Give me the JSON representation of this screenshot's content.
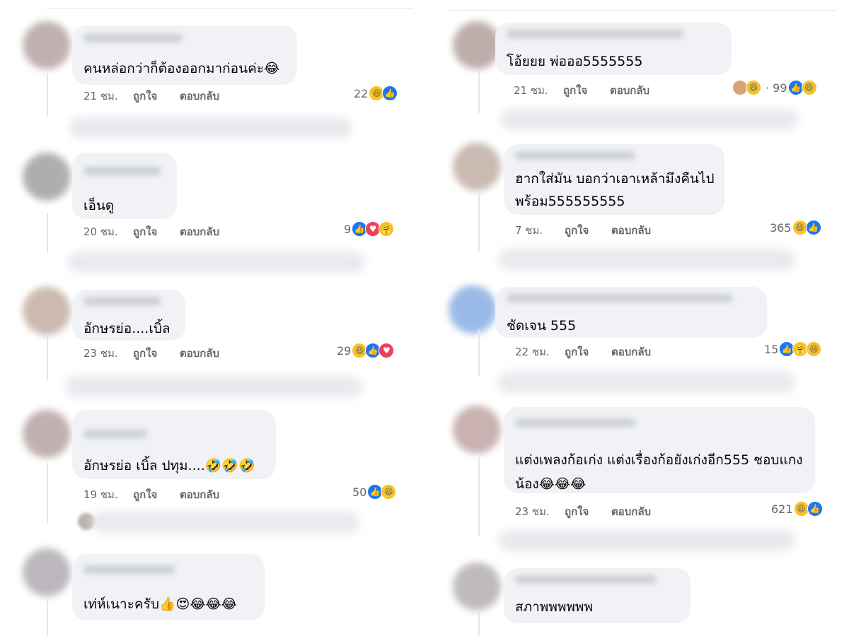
{
  "actions": {
    "like": "ถูกใจ",
    "reply": "ตอบกลับ"
  },
  "left": [
    {
      "text": "คนหล่อกว่าก็ต้องออกมาก่อนค่ะ😂",
      "time": "21 ชม.",
      "count": "22",
      "reactions": [
        "haha-icon",
        "like-icon"
      ]
    },
    {
      "text": "เอ็นดู",
      "time": "20 ชม.",
      "count": "9",
      "reactions": [
        "like-icon",
        "love-icon",
        "care-icon"
      ]
    },
    {
      "text": "อักษรย่อ....เบิ้ล",
      "time": "23 ชม.",
      "count": "29",
      "reactions": [
        "haha-icon",
        "like-icon",
        "love-icon"
      ]
    },
    {
      "text": "อักษรย่อ เบิ้ล ปทุม....🤣🤣🤣",
      "time": "19 ชม.",
      "count": "50",
      "reactions": [
        "like-icon",
        "haha-icon"
      ]
    },
    {
      "text": "เท่ห์เนาะครับ👍😍😂😂😂"
    }
  ],
  "right": [
    {
      "text": "โอ้ยยย พ่อออ5555555",
      "time": "21 ชม.",
      "count": "· 99",
      "reactions": [
        "like-icon",
        "haha-icon"
      ]
    },
    {
      "text": "ฮากใส่มัน บอกว่าเอาเหล้ามึงคืนไป",
      "text2": "พร้อม555555555",
      "time": "7 ชม.",
      "count": "365",
      "reactions": [
        "haha-icon",
        "like-icon"
      ]
    },
    {
      "text": "ชัดเจน 555",
      "time": "22 ชม.",
      "count": "15",
      "reactions": [
        "like-icon",
        "care-icon",
        "haha-icon"
      ]
    },
    {
      "text": "แต่งเพลงก้อเก่ง แต่งเรื่องก้อยังเก่งอีก555 ชอบแกง",
      "text2": "น้อง😂😂😂",
      "time": "23 ชม.",
      "count": "621",
      "reactions": [
        "haha-icon",
        "like-icon"
      ]
    },
    {
      "text": "สภาพพพพพพ"
    }
  ]
}
